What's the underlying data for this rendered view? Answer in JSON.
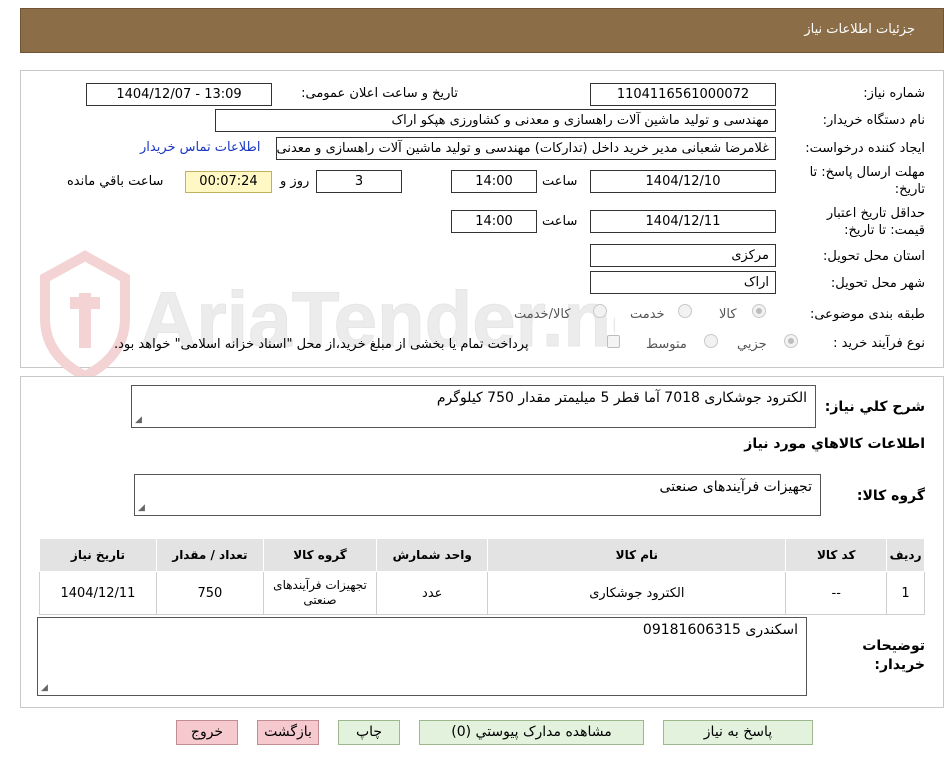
{
  "header": {
    "title": "جزئیات اطلاعات نیاز"
  },
  "watermark": {
    "text": "AriaTender.neT"
  },
  "form": {
    "need_number": {
      "label": "شماره نیاز:",
      "value": "1104116561000072"
    },
    "announce": {
      "label": "تاریخ و ساعت اعلان عمومی:",
      "value": "1404/12/07 - 13:09"
    },
    "buyer_org": {
      "label": "نام دستگاه خریدار:",
      "value": "مهندسی و تولید ماشین آلات راهسازی و معدنی و کشاورزی هپکو اراک"
    },
    "requester": {
      "label": "ایجاد کننده درخواست:",
      "value": "غلامرضا شعبانی مدیر خرید داخل (تدارکات) مهندسی و تولید ماشین آلات راهسازی و معدنی و کشاورزی هپکو اراک",
      "contact_link": "اطلاعات تماس خریدار"
    },
    "deadline": {
      "label_line1": "مهلت ارسال پاسخ: تا",
      "label_line2": "تاریخ:",
      "date": "1404/12/10",
      "time_label": "ساعت",
      "time": "14:00",
      "days": "3",
      "days_label": "روز و",
      "remaining": "00:07:24",
      "remaining_label": "ساعت باقي مانده"
    },
    "validity": {
      "label_line1": "حداقل تاریخ اعتبار",
      "label_line2": "قیمت: تا تاریخ:",
      "date": "1404/12/11",
      "time_label": "ساعت",
      "time": "14:00"
    },
    "province": {
      "label": "استان محل تحویل:",
      "value": "مرکزی"
    },
    "city": {
      "label": "شهر محل تحویل:",
      "value": "اراک"
    },
    "category": {
      "label": "طبقه بندی موضوعی:",
      "options": [
        "کالا",
        "خدمت",
        "کالا/خدمت"
      ],
      "selected": 0
    },
    "process": {
      "label": "نوع فرآیند خرید :",
      "options": [
        "جزیي",
        "متوسط"
      ],
      "selected": 0,
      "checkbox_text": "پرداخت تمام یا بخشی از مبلغ خرید،از محل \"اسناد خزانه اسلامی\" خواهد بود."
    }
  },
  "summary": {
    "label": "شرح کلي نياز:",
    "value": "الکترود جوشکاری 7018 آما قطر 5 میلیمتر مقدار 750 کیلوگرم"
  },
  "goods_section": {
    "title": "اطلاعات کالاهاي مورد نياز"
  },
  "goods_group": {
    "label": "گروه کالا:",
    "value": "تجهیزات فرآیندهای صنعتی"
  },
  "table": {
    "headers": [
      "رديف",
      "کد کالا",
      "نام کالا",
      "واحد شمارش",
      "گروه کالا",
      "تعداد / مقدار",
      "تاريخ نياز"
    ],
    "rows": [
      [
        "1",
        "--",
        "الکترود جوشکاری",
        "عدد",
        "تجهیزات فرآیندهای صنعتی",
        "750",
        "1404/12/11"
      ]
    ]
  },
  "buyer_notes": {
    "label_line1": "توضیحات",
    "label_line2": "خریدار:",
    "value": "اسکندری 09181606315"
  },
  "buttons": {
    "reply": "پاسخ به نیاز",
    "attachments": "مشاهده مدارک پیوستي (0)",
    "print": "چاپ",
    "back": "بازگشت",
    "exit": "خروج"
  }
}
